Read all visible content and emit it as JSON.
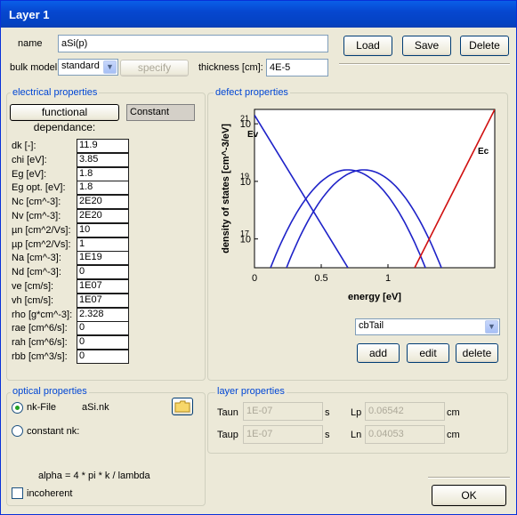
{
  "window": {
    "title": "Layer 1"
  },
  "top": {
    "name_label": "name",
    "name_value": "aSi(p)",
    "bulk_label": "bulk model",
    "bulk_value": "standard",
    "specify_label": "specify",
    "thickness_label": "thickness [cm]:",
    "thickness_value": "4E-5",
    "load_label": "Load",
    "save_label": "Save",
    "delete_label": "Delete"
  },
  "electrical": {
    "title": "electrical properties",
    "func_button": "functional dependance:",
    "func_value": "Constant",
    "rows": [
      {
        "label": "dk [-]:",
        "value": "11.9"
      },
      {
        "label": "chi [eV]:",
        "value": "3.85"
      },
      {
        "label": "Eg [eV]:",
        "value": "1.8"
      },
      {
        "label": "Eg opt. [eV]:",
        "value": "1.8"
      },
      {
        "label": "Nc [cm^-3]:",
        "value": "2E20"
      },
      {
        "label": "Nv [cm^-3]:",
        "value": "2E20"
      },
      {
        "label": "µn [cm^2/Vs]:",
        "value": "10"
      },
      {
        "label": "µp [cm^2/Vs]:",
        "value": "1"
      },
      {
        "label": "Na [cm^-3]:",
        "value": "1E19"
      },
      {
        "label": "Nd [cm^-3]:",
        "value": "0"
      },
      {
        "label": "ve [cm/s]:",
        "value": "1E07"
      },
      {
        "label": "vh [cm/s]:",
        "value": "1E07"
      },
      {
        "label": "rho [g*cm^-3]:",
        "value": "2.328"
      },
      {
        "label": "rae [cm^6/s]:",
        "value": "0"
      },
      {
        "label": "rah [cm^6/s]:",
        "value": "0"
      },
      {
        "label": "rbb [cm^3/s]:",
        "value": "0"
      }
    ]
  },
  "defect": {
    "title": "defect properties",
    "select_value": "cbTail",
    "add_label": "add",
    "edit_label": "edit",
    "delete_label": "delete"
  },
  "chart_data": {
    "type": "line",
    "xlabel": "energy [eV]",
    "ylabel": "density of states [cm^-3/eV]",
    "xlim": [
      0,
      1.8
    ],
    "ylim_log10": [
      16,
      21.5
    ],
    "x_ticks": [
      "0",
      "0.5",
      "1"
    ],
    "x_tick_values": [
      0,
      0.5,
      1
    ],
    "y_ticks": [
      {
        "base": "10",
        "exp": "17",
        "value": 17
      },
      {
        "base": "10",
        "exp": "19",
        "value": 19
      },
      {
        "base": "10",
        "exp": "21",
        "value": 21
      }
    ],
    "annotations": [
      "Ev",
      "Ec"
    ],
    "colors": {
      "valence_and_defects": "#1e22c8",
      "conduction": "#d01010"
    },
    "series": [
      {
        "x": [
          0,
          0.7
        ],
        "log10_y": [
          21.3,
          16.0
        ]
      },
      {
        "x": [
          0.12,
          0.4,
          0.7,
          1.0,
          1.3
        ],
        "log10_y": [
          16.0,
          18.8,
          19.4,
          18.8,
          16.0
        ]
      },
      {
        "x": [
          0.24,
          0.52,
          0.82,
          1.12,
          1.41
        ],
        "log10_y": [
          16.0,
          18.8,
          19.4,
          18.8,
          16.0
        ]
      },
      {
        "x": [
          1.2,
          1.8
        ],
        "log10_y": [
          16.0,
          21.5
        ]
      }
    ]
  },
  "optical": {
    "title": "optical properties",
    "nkfile_label": "nk-File",
    "nkfile_value": "aSi.nk",
    "constant_label": "constant nk:",
    "alpha_text": "alpha = 4 * pi * k / lambda",
    "incoherent_label": "incoherent"
  },
  "layer": {
    "title": "layer properties",
    "taun_label": "Taun",
    "taun_value": "1E-07",
    "taun_unit": "s",
    "taup_label": "Taup",
    "taup_value": "1E-07",
    "taup_unit": "s",
    "lp_label": "Lp",
    "lp_value": "0.06542",
    "lp_unit": "cm",
    "ln_label": "Ln",
    "ln_value": "0.04053",
    "ln_unit": "cm"
  },
  "footer": {
    "ok_label": "OK"
  }
}
